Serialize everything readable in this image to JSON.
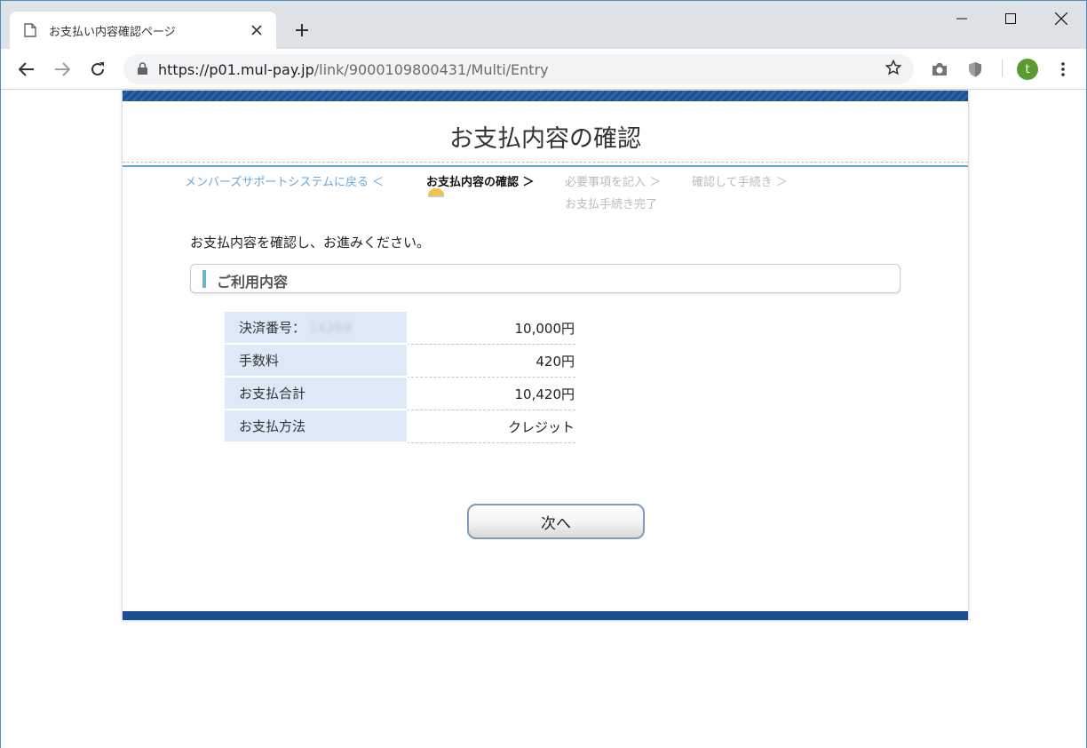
{
  "browser": {
    "tab_title": "お支払い内容確認ページ",
    "url_host": "https://p01.mul-pay.jp",
    "url_path": "/link/9000109800431/Multi/Entry",
    "avatar_letter": "t",
    "accent_color": "#1b4f91"
  },
  "page": {
    "title": "お支払内容の確認",
    "steps": {
      "back": "メンバーズサポートシステムに戻る ＜",
      "current": "お支払内容の確認 ＞",
      "step3": "必要事項を記入 ＞",
      "step4": "確認して手続き ＞",
      "step5": "お支払手続き完了"
    },
    "instruction": "お支払内容を確認し、お進みください。",
    "section_title": "ご利用内容",
    "rows": [
      {
        "label": "決済番号：",
        "masked": "14269",
        "value": "10,000円"
      },
      {
        "label": "手数料",
        "value": "420円"
      },
      {
        "label": "お支払合計",
        "value": "10,420円"
      },
      {
        "label": "お支払方法",
        "value": "クレジット"
      }
    ],
    "next_button": "次へ"
  }
}
